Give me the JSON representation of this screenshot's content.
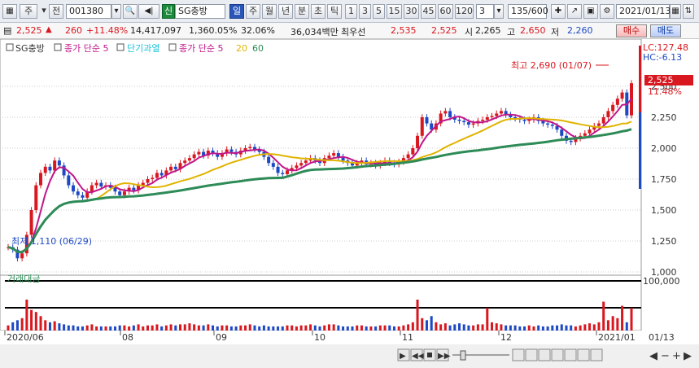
{
  "toolbar": {
    "mode1": "주",
    "mode2": "전",
    "code": "001380",
    "sound": "◀|",
    "badge": "신",
    "name": "SG충방",
    "periods": [
      "일",
      "주",
      "월",
      "년",
      "분",
      "초",
      "틱"
    ],
    "active_period": "일",
    "minutes": [
      "1",
      "3",
      "5",
      "15",
      "30",
      "45",
      "60",
      "120"
    ],
    "selected_minute": "3",
    "count": "135/600",
    "date": "2021/01/13"
  },
  "quote": {
    "price": "2,525",
    "change": "260",
    "change_pct": "+11.48%",
    "volume": "14,417,097",
    "vol_ratio": "1,360.05%",
    "rate": "32.06%",
    "amount": "36,034백만",
    "bid_label": "최우선",
    "ask": "2,535",
    "bid": "2,525",
    "open_label": "시",
    "open": "2,265",
    "high_label": "고",
    "high": "2,650",
    "low_label": "저",
    "low": "2,260",
    "buy_label": "매수",
    "sell_label": "매도"
  },
  "legend": {
    "title": "SG충방",
    "items": [
      {
        "text": "종가 단순 5",
        "color": "#c0168a"
      },
      {
        "text": "단기과열",
        "color": "#19c3d9"
      },
      {
        "text": "종가 단순 5",
        "color": "#c0168a"
      },
      {
        "text": "20",
        "color": "#e0b400"
      },
      {
        "text": "60",
        "color": "#2e8b57"
      }
    ]
  },
  "annotations": {
    "high_marker": "최고 2,690 (01/07)",
    "low_marker": "최저 1,110 (06/29)",
    "lc": "LC:127.48",
    "hc": "HC:-6.13",
    "price_tag": "2,525",
    "pct_tag": "11.48%"
  },
  "volume_panel": {
    "label": "거래대금",
    "axis_label": "100,000"
  },
  "x_labels": [
    "2020/06",
    "08",
    "09",
    "10",
    "11",
    "12",
    "2021/01"
  ],
  "x_end_label": "01/13",
  "colors": {
    "up": "#d8171f",
    "down": "#1d49c4",
    "ma5": "#c0168a",
    "ma20": "#e0b400",
    "ma60": "#2e8b57",
    "hot": "#19c3d9"
  },
  "chart_data": {
    "type": "candlestick",
    "y_ticks": [
      1000,
      1250,
      1500,
      1750,
      2000,
      2250,
      2500
    ],
    "ylim": [
      1000,
      2750
    ],
    "close": [
      1200,
      1180,
      1110,
      1150,
      1300,
      1500,
      1700,
      1800,
      1850,
      1820,
      1900,
      1860,
      1780,
      1700,
      1650,
      1620,
      1600,
      1650,
      1700,
      1720,
      1690,
      1700,
      1680,
      1650,
      1620,
      1650,
      1680,
      1660,
      1700,
      1720,
      1750,
      1760,
      1800,
      1780,
      1820,
      1850,
      1830,
      1880,
      1900,
      1920,
      1950,
      1970,
      1940,
      1980,
      1960,
      1930,
      1960,
      1990,
      1970,
      1950,
      1980,
      2000,
      2010,
      1990,
      1970,
      1930,
      1880,
      1850,
      1800,
      1790,
      1820,
      1840,
      1860,
      1880,
      1900,
      1920,
      1900,
      1880,
      1920,
      1940,
      1960,
      1930,
      1900,
      1880,
      1860,
      1880,
      1900,
      1870,
      1880,
      1860,
      1880,
      1900,
      1880,
      1870,
      1890,
      1920,
      1950,
      2000,
      2100,
      2250,
      2200,
      2150,
      2200,
      2280,
      2300,
      2250,
      2230,
      2220,
      2210,
      2190,
      2200,
      2220,
      2230,
      2250,
      2260,
      2280,
      2300,
      2270,
      2250,
      2240,
      2230,
      2220,
      2230,
      2250,
      2220,
      2200,
      2190,
      2180,
      2150,
      2100,
      2060,
      2050,
      2080,
      2100,
      2120,
      2150,
      2180,
      2200,
      2250,
      2300,
      2350,
      2400,
      2450,
      2265,
      2525
    ],
    "volume": [
      5,
      8,
      10,
      12,
      30,
      20,
      18,
      14,
      10,
      8,
      9,
      7,
      6,
      5,
      5,
      4,
      4,
      5,
      6,
      4,
      4,
      4,
      4,
      4,
      5,
      5,
      4,
      5,
      6,
      4,
      5,
      5,
      6,
      4,
      5,
      6,
      5,
      6,
      6,
      7,
      6,
      5,
      5,
      6,
      5,
      4,
      5,
      5,
      4,
      4,
      5,
      5,
      6,
      5,
      4,
      5,
      4,
      4,
      4,
      4,
      5,
      5,
      4,
      5,
      5,
      6,
      5,
      4,
      5,
      6,
      6,
      5,
      4,
      4,
      4,
      5,
      5,
      4,
      4,
      4,
      5,
      5,
      5,
      4,
      4,
      5,
      6,
      8,
      30,
      12,
      10,
      14,
      8,
      6,
      7,
      5,
      6,
      7,
      6,
      5,
      5,
      6,
      6,
      22,
      8,
      7,
      6,
      5,
      5,
      5,
      4,
      4,
      5,
      4,
      5,
      4,
      4,
      5,
      5,
      6,
      5,
      5,
      4,
      5,
      6,
      7,
      6,
      8,
      28,
      10,
      14,
      12,
      24,
      8,
      22
    ],
    "ma_periods": [
      5,
      20,
      60
    ]
  }
}
